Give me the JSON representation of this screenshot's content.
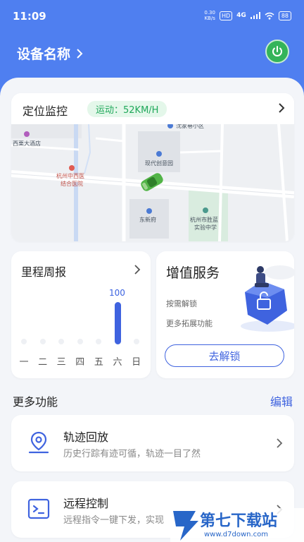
{
  "status_bar": {
    "time": "11:09",
    "net_speed_value": "0.30",
    "net_speed_unit": "KB/s",
    "hd_badge": "HD",
    "signal": "4G",
    "battery": "88"
  },
  "header": {
    "device_name": "设备名称",
    "power_icon": "power-icon"
  },
  "location_card": {
    "title": "定位监控",
    "speed": "运动：52KM/H",
    "map_labels": {
      "hotel": "西栗大酒店",
      "xiaoqu": "沈家巷小区",
      "garden": "现代创意园",
      "hospital_1": "杭州中西医",
      "hospital_2": "结合医院",
      "dongxinfu": "东新府",
      "school_1": "杭州市胜蓝",
      "school_2": "实验中学"
    }
  },
  "mileage_card": {
    "title": "里程周报",
    "days": [
      "一",
      "二",
      "三",
      "四",
      "五",
      "六",
      "日"
    ],
    "values": [
      0,
      0,
      0,
      0,
      0,
      100,
      0
    ],
    "value_label": "100",
    "accent": "#3f63df"
  },
  "vas_card": {
    "title": "增值服务",
    "line1": "按需解锁",
    "line2": "更多拓展功能",
    "button": "去解锁"
  },
  "more": {
    "title": "更多功能",
    "edit": "编辑"
  },
  "features": [
    {
      "title": "轨迹回放",
      "desc": "历史行踪有迹可循，轨迹一目了然",
      "icon": "location-pin-icon"
    },
    {
      "title": "远程控制",
      "desc": "远程指令一键下发，实现",
      "icon": "terminal-icon"
    }
  ],
  "watermark": {
    "text": "第七下载站",
    "url": "www.d7down.com"
  },
  "colors": {
    "header_blue": "#4f7ff0",
    "accent_blue": "#3f63df",
    "power_green": "#34b45a",
    "speed_green": "#1fa85a"
  }
}
